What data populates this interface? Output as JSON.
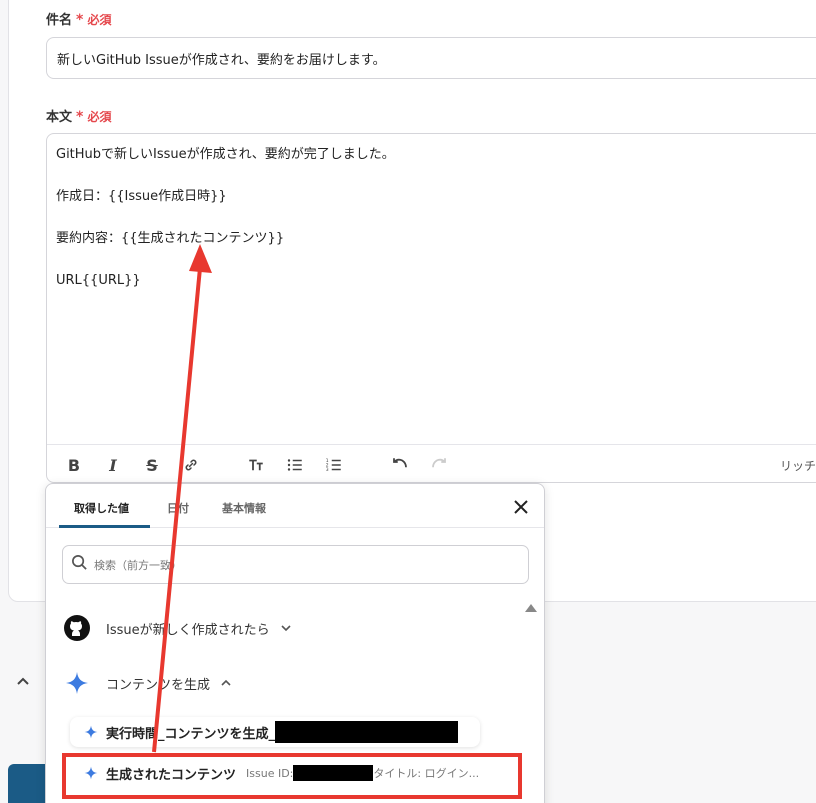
{
  "form": {
    "subject_label": "件名",
    "body_label": "本文",
    "required": "必須",
    "subject_value": "新しいGitHub Issueが作成され、要約をお届けします。",
    "body_lines": [
      "GitHubで新しいIssueが作成され、要約が完了しました。",
      "",
      "作成日：{{Issue作成日時}}",
      "",
      "要約内容：{{生成されたコンテンツ}}",
      "",
      "URL{{URL}}"
    ],
    "rich_label": "リッチ"
  },
  "dropdown": {
    "tabs": [
      "取得した値",
      "日付",
      "基本情報"
    ],
    "search_placeholder": "検索（前方一致）",
    "groups": [
      {
        "label": "Issueが新しく作成されたら",
        "icon": "github-icon"
      },
      {
        "label": "コンテンツを生成",
        "icon": "sparkle-icon"
      }
    ],
    "items": [
      {
        "name": "実行時間_コンテンツを生成_",
        "meta": ""
      },
      {
        "name": "生成されたコンテンツ",
        "meta": "Issue ID:",
        "meta2": "タイトル: ログイン..."
      }
    ]
  },
  "colors": {
    "accent": "#1b5b86",
    "required": "#e5484d",
    "annotation": "#e8382f"
  }
}
